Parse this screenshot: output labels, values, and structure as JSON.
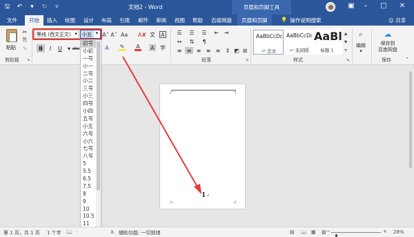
{
  "titlebar": {
    "doc_title": "文档2 - Word",
    "context_title": "页眉和页脚工具"
  },
  "tabs": [
    {
      "label": "文件"
    },
    {
      "label": "开始"
    },
    {
      "label": "插入"
    },
    {
      "label": "绘图"
    },
    {
      "label": "设计"
    },
    {
      "label": "布局"
    },
    {
      "label": "引用"
    },
    {
      "label": "邮件"
    },
    {
      "label": "审阅"
    },
    {
      "label": "视图"
    },
    {
      "label": "帮助"
    },
    {
      "label": "百度网盘"
    },
    {
      "label": "页眉和页脚"
    }
  ],
  "tellme": "操作说明搜索",
  "share": "共享",
  "ribbon": {
    "paste_label": "粘贴",
    "clipboard_label": "剪贴板",
    "font_name": "等线 (西文正文)",
    "font_size": "小五",
    "paragraph_label": "段落",
    "styles_label": "样式",
    "styles": [
      {
        "sample": "AaBbCcDc",
        "name": "↵ 正文"
      },
      {
        "sample": "AaBbCcDc",
        "name": "↵ 无间隔"
      },
      {
        "sample": "AaBl",
        "name": "标题 1"
      }
    ],
    "edit_label": "编辑",
    "save_baidu_line1": "保存到",
    "save_baidu_line2": "百度网盘",
    "save_label": "保存"
  },
  "font_sizes": {
    "options": [
      "初号",
      "小初",
      "一号",
      "小一",
      "二号",
      "小二",
      "三号",
      "小三",
      "四号",
      "小四",
      "五号",
      "小五",
      "六号",
      "小六",
      "七号",
      "八号",
      "5",
      "5.5",
      "6.5",
      "7.5",
      "8",
      "9",
      "10",
      "10.5",
      "11"
    ],
    "highlighted_index": 0
  },
  "document": {
    "page_number": "1",
    "para_mark": "↵"
  },
  "statusbar": {
    "page_info": "第 1 页，共 1 页",
    "word_count": "1 个字",
    "accessibility": "辅助功能: 一切就绪",
    "zoom": "28%",
    "zoom_level": 0.28
  },
  "colors": {
    "brand": "#2b579a",
    "annotation": "#e53935"
  }
}
